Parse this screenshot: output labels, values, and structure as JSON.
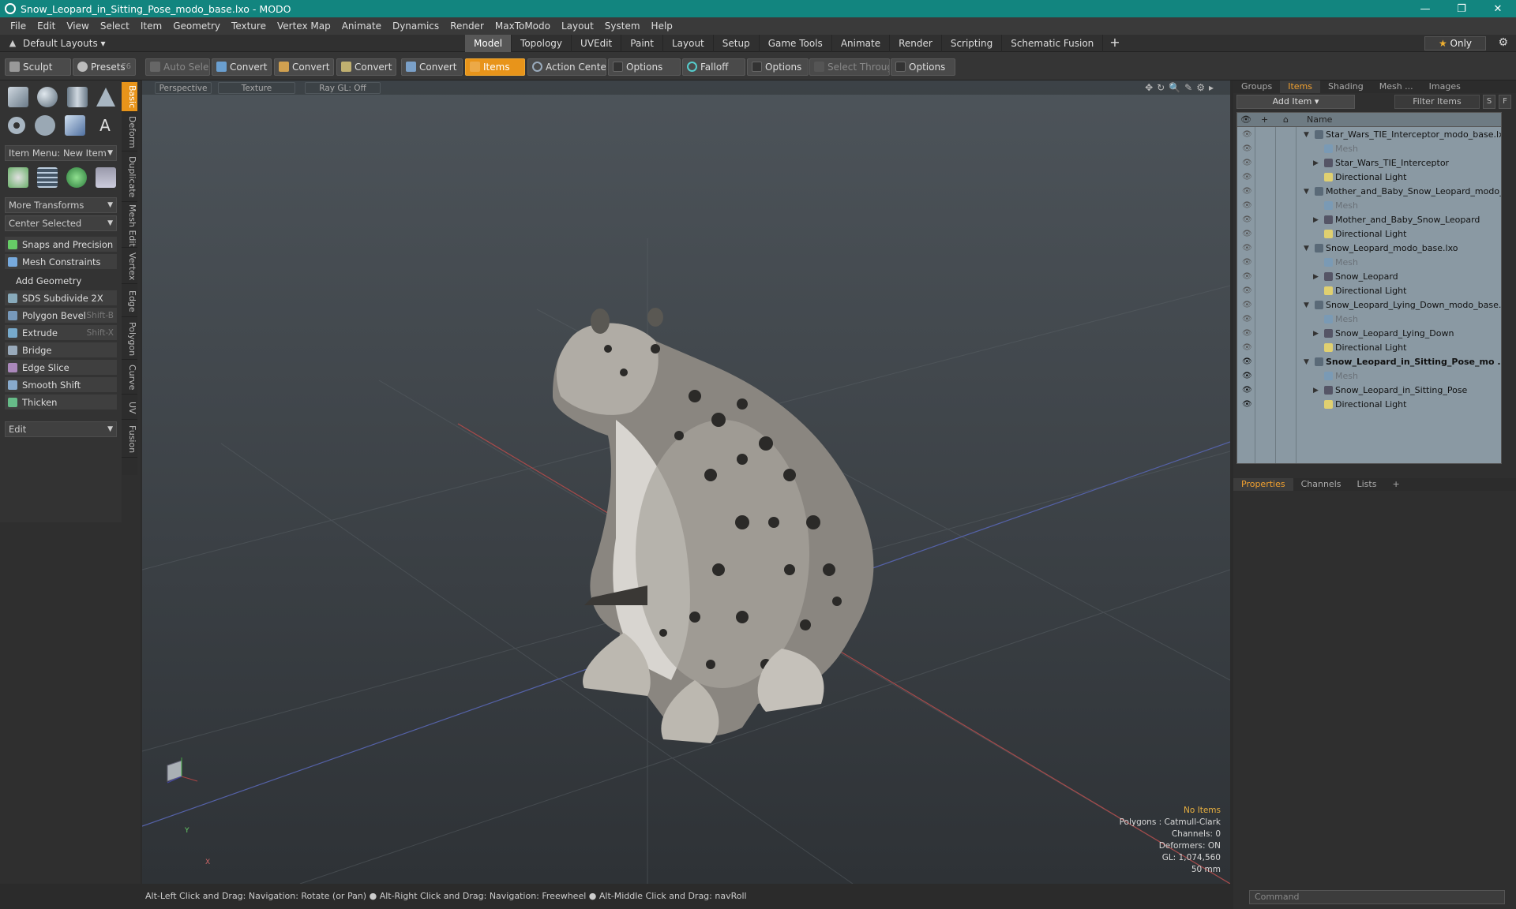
{
  "window": {
    "title": "Snow_Leopard_in_Sitting_Pose_modo_base.lxo - MODO",
    "minimize": "—",
    "restore": "❐",
    "close": "✕"
  },
  "menu": [
    "File",
    "Edit",
    "View",
    "Select",
    "Item",
    "Geometry",
    "Texture",
    "Vertex Map",
    "Animate",
    "Dynamics",
    "Render",
    "MaxToModo",
    "Layout",
    "System",
    "Help"
  ],
  "layouts": {
    "dropdown": "Default Layouts ▾",
    "tabs": [
      "Model",
      "Topology",
      "UVEdit",
      "Paint",
      "Layout",
      "Setup",
      "Game Tools",
      "Animate",
      "Render",
      "Scripting",
      "Schematic Fusion"
    ],
    "add": "+",
    "only": "Only",
    "star": "★"
  },
  "toolbar": {
    "sculpt": "Sculpt",
    "presets": "Presets",
    "presets_key": "F6",
    "auto_select": "Auto Select",
    "convert1": "Convert",
    "convert2": "Convert",
    "convert3": "Convert",
    "convert4": "Convert",
    "items": "Items",
    "action_center": "Action Center",
    "options1": "Options",
    "falloff": "Falloff",
    "options2": "Options",
    "select_through": "Select Through",
    "options3": "Options"
  },
  "left": {
    "vtabs": [
      "Basic",
      "Deform",
      "Duplicate",
      "Mesh Edit",
      "Vertex",
      "Edge",
      "Polygon",
      "Curve",
      "UV",
      "Fusion"
    ],
    "item_menu": "Item Menu: New Item",
    "more_transforms": "More Transforms",
    "center_selected": "Center Selected",
    "snaps": "Snaps and Precision",
    "mesh_constraints": "Mesh Constraints",
    "add_geometry": "Add Geometry",
    "tools": [
      {
        "label": "SDS Subdivide 2X",
        "key": ""
      },
      {
        "label": "Polygon Bevel",
        "key": "Shift-B"
      },
      {
        "label": "Extrude",
        "key": "Shift-X"
      },
      {
        "label": "Bridge",
        "key": ""
      },
      {
        "label": "Edge Slice",
        "key": ""
      },
      {
        "label": "Smooth Shift",
        "key": ""
      },
      {
        "label": "Thicken",
        "key": ""
      }
    ],
    "edit": "Edit"
  },
  "viewport": {
    "labels": [
      "Perspective",
      "Texture",
      "Ray GL: Off"
    ],
    "info": {
      "no_items": "No Items",
      "polygons": "Polygons : Catmull-Clark",
      "channels": "Channels: 0",
      "deformers": "Deformers: ON",
      "gl": "GL: 1,074,560",
      "focal": "50 mm"
    },
    "axis_y": "Y",
    "axis_x": "X"
  },
  "status": "Alt-Left Click and Drag: Navigation: Rotate (or Pan) ● Alt-Right Click and Drag: Navigation: Freewheel ● Alt-Middle Click and Drag: navRoll",
  "right": {
    "tabs": [
      "Groups",
      "Items",
      "Shading",
      "Mesh ...",
      "Images"
    ],
    "add_item": "Add Item",
    "filter": "Filter Items",
    "s": "S",
    "f": "F",
    "name_col": "Name",
    "tree": [
      {
        "name": "Star_Wars_TIE_Interceptor_modo_base.lxo",
        "level": 0,
        "type": "scene",
        "arrow": "▼",
        "eye": false
      },
      {
        "name": "Mesh",
        "level": 1,
        "type": "mesh",
        "arrow": "",
        "eye": false,
        "dim": true
      },
      {
        "name": "Star_Wars_TIE_Interceptor",
        "level": 1,
        "type": "group",
        "arrow": "▶",
        "eye": false
      },
      {
        "name": "Directional Light",
        "level": 1,
        "type": "light",
        "arrow": "",
        "eye": false
      },
      {
        "name": "Mother_and_Baby_Snow_Leopard_modo_...",
        "level": 0,
        "type": "scene",
        "arrow": "▼",
        "eye": false
      },
      {
        "name": "Mesh",
        "level": 1,
        "type": "mesh",
        "arrow": "",
        "eye": false,
        "dim": true
      },
      {
        "name": "Mother_and_Baby_Snow_Leopard",
        "level": 1,
        "type": "group",
        "arrow": "▶",
        "eye": false
      },
      {
        "name": "Directional Light",
        "level": 1,
        "type": "light",
        "arrow": "",
        "eye": false
      },
      {
        "name": "Snow_Leopard_modo_base.lxo",
        "level": 0,
        "type": "scene",
        "arrow": "▼",
        "eye": false
      },
      {
        "name": "Mesh",
        "level": 1,
        "type": "mesh",
        "arrow": "",
        "eye": false,
        "dim": true
      },
      {
        "name": "Snow_Leopard",
        "level": 1,
        "type": "group",
        "arrow": "▶",
        "eye": false
      },
      {
        "name": "Directional Light",
        "level": 1,
        "type": "light",
        "arrow": "",
        "eye": false
      },
      {
        "name": "Snow_Leopard_Lying_Down_modo_base.lxo",
        "level": 0,
        "type": "scene",
        "arrow": "▼",
        "eye": false
      },
      {
        "name": "Mesh",
        "level": 1,
        "type": "mesh",
        "arrow": "",
        "eye": false,
        "dim": true
      },
      {
        "name": "Snow_Leopard_Lying_Down",
        "level": 1,
        "type": "group",
        "arrow": "▶",
        "eye": false
      },
      {
        "name": "Directional Light",
        "level": 1,
        "type": "light",
        "arrow": "",
        "eye": false
      },
      {
        "name": "Snow_Leopard_in_Sitting_Pose_mo ...",
        "level": 0,
        "type": "scene",
        "arrow": "▼",
        "eye": true,
        "bold": true
      },
      {
        "name": "Mesh",
        "level": 1,
        "type": "mesh",
        "arrow": "",
        "eye": true,
        "dim": true
      },
      {
        "name": "Snow_Leopard_in_Sitting_Pose",
        "level": 1,
        "type": "group",
        "arrow": "▶",
        "eye": true
      },
      {
        "name": "Directional Light",
        "level": 1,
        "type": "light",
        "arrow": "",
        "eye": true
      }
    ],
    "prop_tabs": [
      "Properties",
      "Channels",
      "Lists"
    ],
    "prop_add": "+",
    "command": "Command"
  },
  "colors": {
    "accent": "#e8941a",
    "titlebar": "#12857f"
  }
}
